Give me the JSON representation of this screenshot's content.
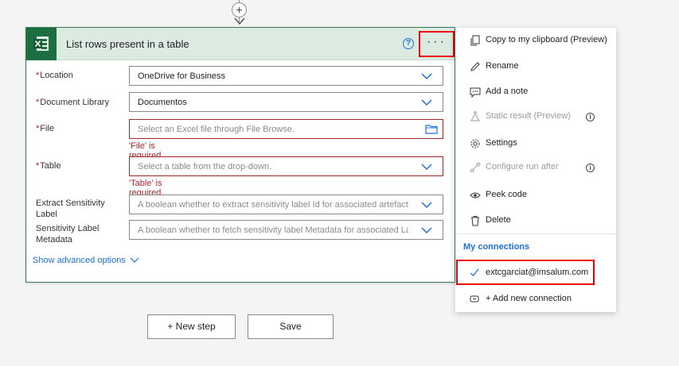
{
  "card": {
    "title": "List rows present in a table",
    "help": "?",
    "more": "···",
    "fields": [
      {
        "label": "Location",
        "required": true,
        "value": "OneDrive for Business",
        "placeholder": false
      },
      {
        "label": "Document Library",
        "required": true,
        "value": "Documentos",
        "placeholder": false
      },
      {
        "label": "File",
        "required": true,
        "value": "Select an Excel file through File Browse.",
        "placeholder": true,
        "error": "'File' is required."
      },
      {
        "label": "Table",
        "required": true,
        "value": "Select a table from the drop-down.",
        "placeholder": true,
        "error": "'Table' is required."
      },
      {
        "label": "Extract Sensitivity Label",
        "required": false,
        "value": "A boolean whether to extract sensitivity label Id for associated artefact.",
        "placeholder": true
      },
      {
        "label": "Sensitivity Label Metadata",
        "required": false,
        "value": "A boolean whether to fetch sensitivity label Metadata for associated Labe",
        "placeholder": true
      }
    ],
    "advanced": "Show advanced options"
  },
  "menu": {
    "items": [
      {
        "label": "Copy to my clipboard (Preview)",
        "icon": "copy-icon",
        "disabled": false
      },
      {
        "label": "Rename",
        "icon": "pencil-icon",
        "disabled": false
      },
      {
        "label": "Add a note",
        "icon": "note-icon",
        "disabled": false
      },
      {
        "label": "Static result (Preview)",
        "icon": "flask-icon",
        "disabled": true,
        "info": true
      },
      {
        "label": "Settings",
        "icon": "gear-icon",
        "disabled": false
      },
      {
        "label": "Configure run after",
        "icon": "run-after-icon",
        "disabled": true,
        "info": true
      },
      {
        "label": "Peek code",
        "icon": "eye-icon",
        "disabled": false
      },
      {
        "label": "Delete",
        "icon": "trash-icon",
        "disabled": false
      }
    ],
    "section": "My connections",
    "connection": "extcgarciat@imsalum.com",
    "add_connection": "+ Add new connection"
  },
  "buttons": {
    "new_step": "+ New step",
    "save": "Save"
  },
  "colors": {
    "accent": "#1e6fd9",
    "excel_green": "#1d6f42",
    "header_bg": "#dcebe2",
    "error": "#a4262c",
    "highlight": "#ee0000"
  }
}
